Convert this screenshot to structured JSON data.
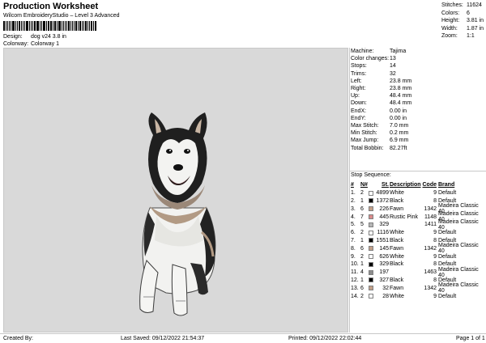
{
  "header": {
    "title": "Production Worksheet",
    "subtitle": "Wilcom EmbroideryStudio – Level 3 Advanced",
    "design_label": "Design:",
    "design_value": "dog v24 3.8 in",
    "colorway_label": "Colorway:",
    "colorway_value": "Colorway 1"
  },
  "stats": [
    {
      "label": "Stitches:",
      "value": "11624"
    },
    {
      "label": "Colors:",
      "value": "6"
    },
    {
      "label": "Height:",
      "value": "3.81 in"
    },
    {
      "label": "Width:",
      "value": "1.87 in"
    },
    {
      "label": "Zoom:",
      "value": "1:1"
    }
  ],
  "machine": [
    {
      "label": "Machine:",
      "value": "Tajima"
    },
    {
      "label": "Color changes:",
      "value": "13"
    },
    {
      "label": "Stops:",
      "value": "14"
    },
    {
      "label": "Trims:",
      "value": "32"
    },
    {
      "label": "Left:",
      "value": "23.8 mm"
    },
    {
      "label": "Right:",
      "value": "23.8 mm"
    },
    {
      "label": "Up:",
      "value": "48.4 mm"
    },
    {
      "label": "Down:",
      "value": "48.4 mm"
    },
    {
      "label": "EndX:",
      "value": "0.00 in"
    },
    {
      "label": "EndY:",
      "value": "0.00 in"
    },
    {
      "label": "Max Stitch:",
      "value": "7.0 mm"
    },
    {
      "label": "Min Stitch:",
      "value": "0.2 mm"
    },
    {
      "label": "Max Jump:",
      "value": "6.9 mm"
    },
    {
      "label": "Total Bobbin:",
      "value": "82.27ft"
    }
  ],
  "stop_sequence": {
    "title": "Stop Sequence:",
    "headers": [
      "#",
      "N#",
      "St.",
      "Description",
      "Code",
      "Brand"
    ],
    "rows": [
      {
        "num": "1.",
        "n": "2",
        "color": "#ffffff",
        "st": "4899",
        "desc": "White",
        "code": "9",
        "brand": "Default"
      },
      {
        "num": "2.",
        "n": "1",
        "color": "#000000",
        "st": "1372",
        "desc": "Black",
        "code": "8",
        "brand": "Default"
      },
      {
        "num": "3.",
        "n": "6",
        "color": "#c2a08a",
        "st": "226",
        "desc": "Fawn",
        "code": "1342",
        "brand": "Madeira Classic 40"
      },
      {
        "num": "4.",
        "n": "7",
        "color": "#d98a8a",
        "st": "445",
        "desc": "Rustic Pink",
        "code": "1148",
        "brand": "Madeira Classic 40"
      },
      {
        "num": "5.",
        "n": "5",
        "color": "#b5b5b5",
        "st": "329",
        "desc": "",
        "code": "1411",
        "brand": "Madeira Classic 40"
      },
      {
        "num": "6.",
        "n": "2",
        "color": "#ffffff",
        "st": "1116",
        "desc": "White",
        "code": "9",
        "brand": "Default"
      },
      {
        "num": "7.",
        "n": "1",
        "color": "#000000",
        "st": "1551",
        "desc": "Black",
        "code": "8",
        "brand": "Default"
      },
      {
        "num": "8.",
        "n": "6",
        "color": "#c2a08a",
        "st": "145",
        "desc": "Fawn",
        "code": "1342",
        "brand": "Madeira Classic 40"
      },
      {
        "num": "9.",
        "n": "2",
        "color": "#ffffff",
        "st": "626",
        "desc": "White",
        "code": "9",
        "brand": "Default"
      },
      {
        "num": "10.",
        "n": "1",
        "color": "#000000",
        "st": "329",
        "desc": "Black",
        "code": "8",
        "brand": "Default"
      },
      {
        "num": "11.",
        "n": "4",
        "color": "#8c8c8c",
        "st": "197",
        "desc": "",
        "code": "1463",
        "brand": "Madeira Classic 40"
      },
      {
        "num": "12.",
        "n": "1",
        "color": "#000000",
        "st": "327",
        "desc": "Black",
        "code": "8",
        "brand": "Default"
      },
      {
        "num": "13.",
        "n": "6",
        "color": "#c2a08a",
        "st": "32",
        "desc": "Fawn",
        "code": "1342",
        "brand": "Madeira Classic 40"
      },
      {
        "num": "14.",
        "n": "2",
        "color": "#ffffff",
        "st": "28",
        "desc": "White",
        "code": "9",
        "brand": "Default"
      }
    ]
  },
  "footer": {
    "created": "Created By:",
    "last_saved": "Last Saved: 09/12/2022 21:54:37",
    "printed": "Printed: 09/12/2022 22:02:44",
    "page": "Page 1 of 1"
  }
}
